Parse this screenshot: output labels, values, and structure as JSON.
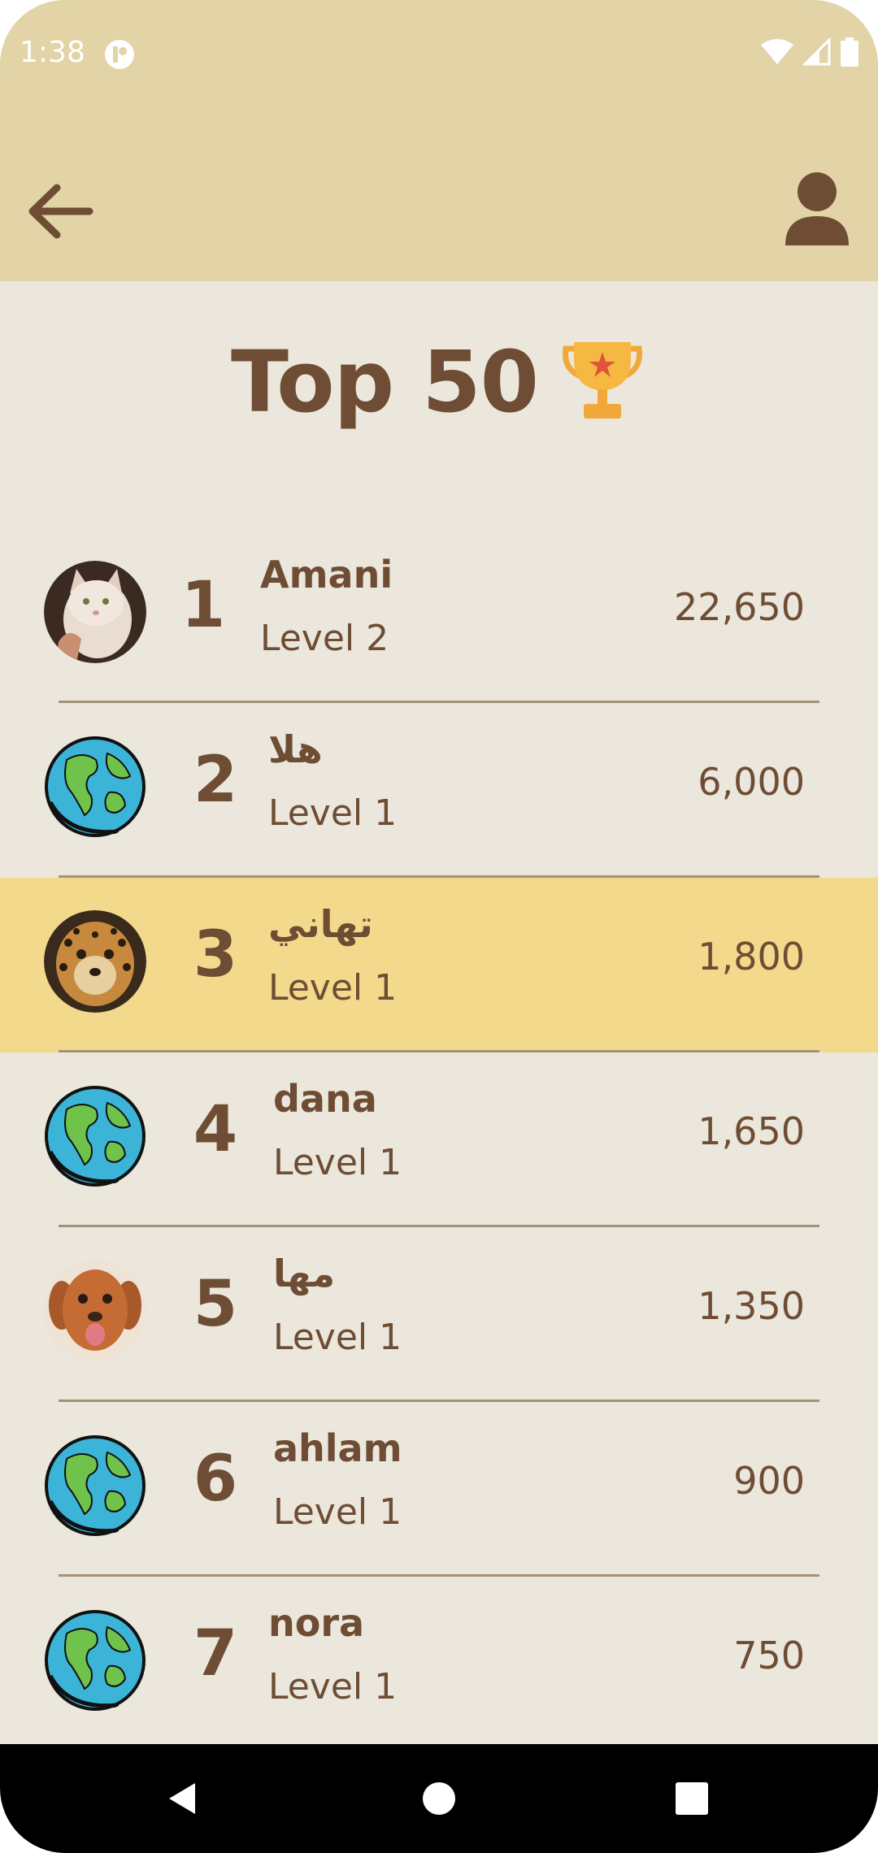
{
  "status_bar": {
    "time": "1:38"
  },
  "header": {
    "back_icon": "arrow-left-icon",
    "profile_icon": "person-icon"
  },
  "page": {
    "title": "Top 50",
    "title_icon": "trophy-icon"
  },
  "colors": {
    "appbar": "#e2d4a7",
    "background": "#ebe7dc",
    "highlight_row": "#f3d98c",
    "text": "#6e4d34",
    "divider": "#a39178"
  },
  "leaderboard": {
    "rows": [
      {
        "rank": "1",
        "name": "Amani",
        "level": "Level 2",
        "score": "22,650",
        "avatar": "cat-photo",
        "highlighted": false
      },
      {
        "rank": "2",
        "name": "هلا",
        "level": "Level 1",
        "score": "6,000",
        "avatar": "globe-icon",
        "highlighted": false
      },
      {
        "rank": "3",
        "name": "تهاني",
        "level": "Level 1",
        "score": "1,800",
        "avatar": "leopard-photo",
        "highlighted": true
      },
      {
        "rank": "4",
        "name": "dana",
        "level": "Level 1",
        "score": "1,650",
        "avatar": "globe-icon",
        "highlighted": false
      },
      {
        "rank": "5",
        "name": "مها",
        "level": "Level 1",
        "score": "1,350",
        "avatar": "dog-photo",
        "highlighted": false
      },
      {
        "rank": "6",
        "name": "ahlam",
        "level": "Level 1",
        "score": "900",
        "avatar": "globe-icon",
        "highlighted": false
      },
      {
        "rank": "7",
        "name": "nora",
        "level": "Level 1",
        "score": "750",
        "avatar": "globe-icon",
        "highlighted": false
      }
    ]
  },
  "nav_bar": {
    "back": "nav-back-icon",
    "home": "nav-home-icon",
    "recents": "nav-recents-icon"
  }
}
